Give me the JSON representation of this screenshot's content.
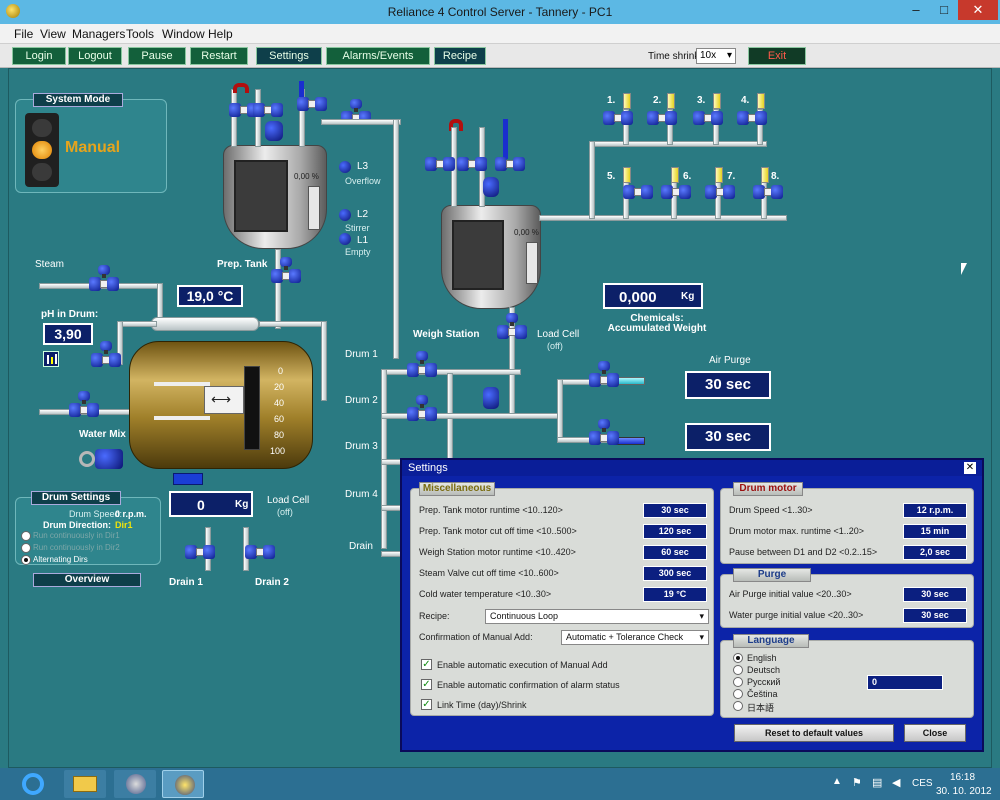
{
  "window": {
    "title": "Reliance 4 Control Server - Tannery - PC1",
    "minimize": "–",
    "maximize": "□",
    "close": "✕"
  },
  "menu": [
    "File",
    "View",
    "Managers",
    "Tools",
    "Window",
    "Help"
  ],
  "toolbar": {
    "buttons": [
      "Login",
      "Logout",
      "Pause",
      "Restart",
      "Settings",
      "Alarms/Events",
      "Recipe"
    ],
    "time_shrink_label": "Time shrink",
    "time_shrink_value": "10x",
    "exit_label": "Exit"
  },
  "system_mode": {
    "title": "System Mode",
    "mode": "Manual"
  },
  "steam_label": "Steam",
  "ph": {
    "label": "pH in Drum:",
    "value": "3,90"
  },
  "temperature": "19,0 °C",
  "water_mix_label": "Water Mix",
  "drum_scale": [
    "0",
    "20",
    "40",
    "60",
    "80",
    "100"
  ],
  "drum_weight": {
    "value": "0",
    "unit": "Kg"
  },
  "load_cell_1": {
    "label": "Load Cell",
    "state": "(off)"
  },
  "drum_settings": {
    "title": "Drum Settings",
    "speed_label": "Drum Speed:",
    "speed_value": "0 r.p.m.",
    "direction_label": "Drum Direction:",
    "direction_value": "Dir1",
    "options": [
      "Run continuously in Dir1",
      "Run continuously in Dir2",
      "Alternating Dirs"
    ],
    "overview": "Overview"
  },
  "drains": [
    "Drain 1",
    "Drain 2"
  ],
  "prep_tank": {
    "label": "Prep. Tank",
    "level": "0,00 %",
    "levels": [
      {
        "name": "L3",
        "desc": "Overflow"
      },
      {
        "name": "L2",
        "desc": "Stirrer"
      },
      {
        "name": "L1",
        "desc": "Empty"
      }
    ]
  },
  "weigh_station": {
    "label": "Weigh Station",
    "level": "0,00 %"
  },
  "load_cell_2": {
    "label": "Load Cell",
    "state": "(off)"
  },
  "chemicals": {
    "value": "0,000",
    "unit": "Kg",
    "label1": "Chemicals:",
    "label2": "Accumulated Weight"
  },
  "chemical_lines": [
    "1.",
    "2.",
    "3.",
    "4.",
    "5.",
    "6.",
    "7.",
    "8."
  ],
  "drum_lines": [
    "Drum 1",
    "Drum 2",
    "Drum 3",
    "Drum 4",
    "Drain"
  ],
  "air_purge": {
    "label": "Air Purge",
    "value1": "30 sec",
    "value2": "30 sec"
  },
  "settings": {
    "title": "Settings",
    "close": "✕",
    "misc_title": "Miscellaneous",
    "misc_rows": [
      {
        "label": "Prep. Tank motor runtime <10..120>",
        "value": "30 sec"
      },
      {
        "label": "Prep. Tank motor cut off time <10..500>",
        "value": "120 sec"
      },
      {
        "label": "Weigh Station motor runtime <10..420>",
        "value": "60 sec"
      },
      {
        "label": "Steam Valve cut off time <10..600>",
        "value": "300 sec"
      },
      {
        "label": "Cold water temperature <10..30>",
        "value": "19 °C"
      }
    ],
    "recipe_label": "Recipe:",
    "recipe_value": "Continuous Loop",
    "confirm_label": "Confirmation of Manual Add:",
    "confirm_value": "Automatic + Tolerance Check",
    "checks": [
      "Enable automatic execution of Manual Add",
      "Enable automatic confirmation of alarm status",
      "Link Time (day)/Shrink"
    ],
    "drum_motor_title": "Drum motor",
    "drum_rows": [
      {
        "label": "Drum Speed <1..30>",
        "value": "12 r.p.m."
      },
      {
        "label": "Drum motor max. runtime <1..20>",
        "value": "15 min"
      },
      {
        "label": "Pause between D1 and D2 <0.2..15>",
        "value": "2,0 sec"
      }
    ],
    "purge_title": "Purge",
    "purge_rows": [
      {
        "label": "Air Purge initial value <20..30>",
        "value": "30 sec"
      },
      {
        "label": "Water purge initial value <20..30>",
        "value": "30 sec"
      }
    ],
    "language_title": "Language",
    "languages": [
      "English",
      "Deutsch",
      "Русский",
      "Čeština",
      "日本語"
    ],
    "language_value": "0",
    "reset": "Reset to default values",
    "close_button": "Close"
  },
  "taskbar": {
    "lang": "CES",
    "time": "16:18",
    "date": "30. 10. 2012"
  }
}
